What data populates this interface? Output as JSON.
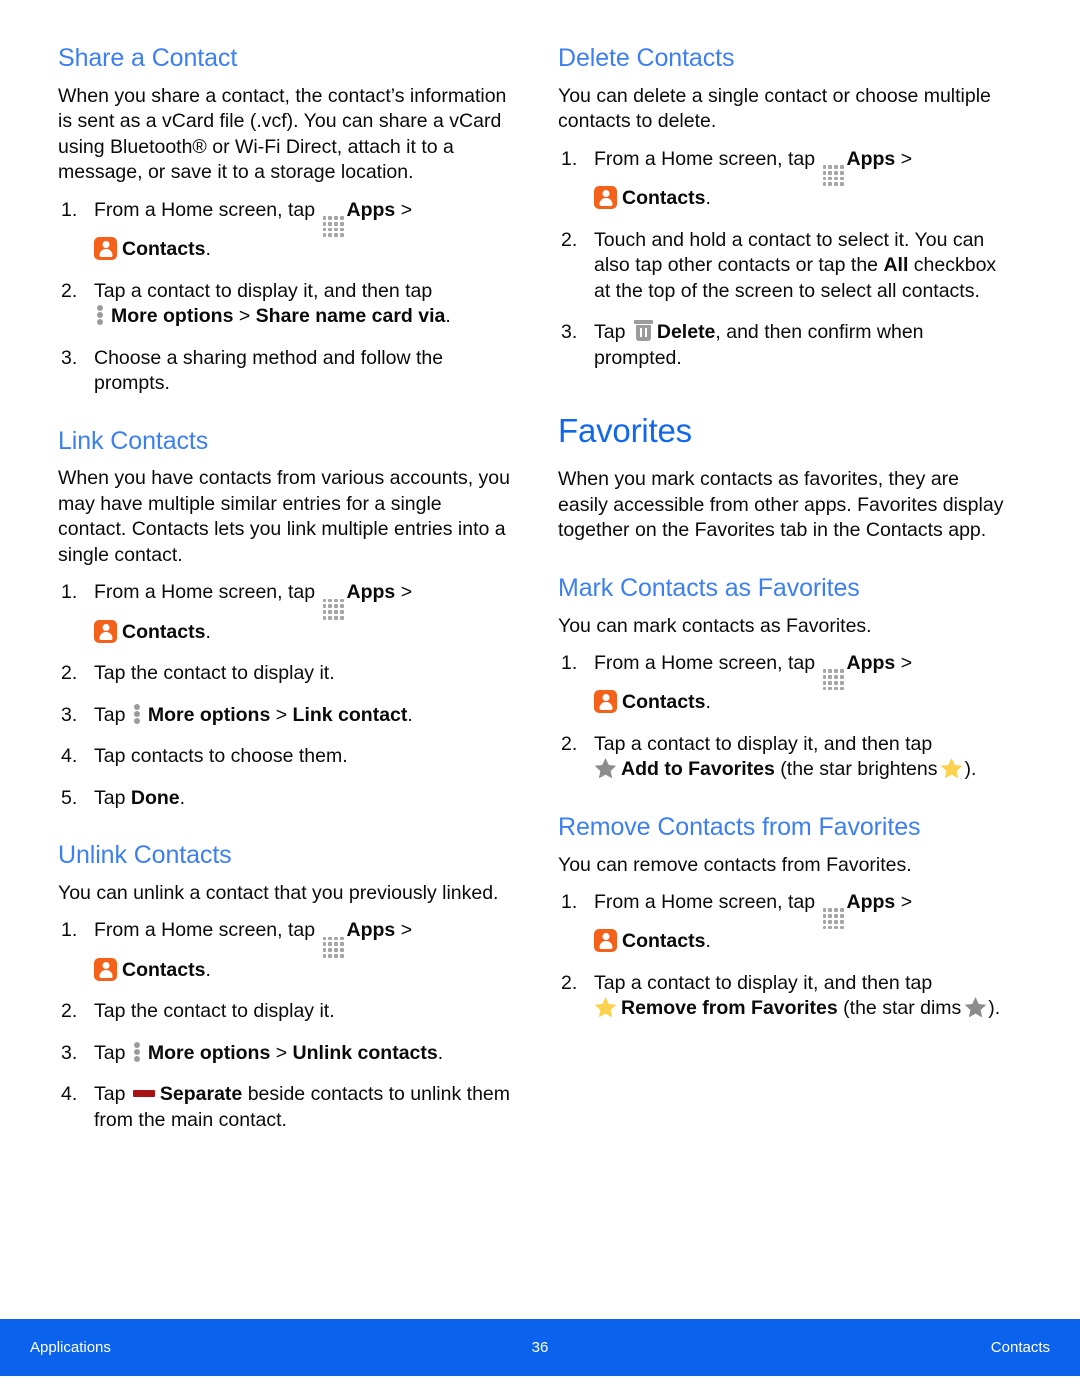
{
  "document": {
    "title": "Contacts — Share, Link, Unlink, Delete, Favorites"
  },
  "icons": {
    "apps": "apps-grid-icon",
    "contacts": "contacts-app-icon",
    "more_options": "more-options-icon",
    "delete": "trash-icon",
    "separate": "separate-dash-icon",
    "star_dim": "star-gray-icon",
    "star_bright": "star-yellow-icon"
  },
  "colors": {
    "h1_blue": "#1268ec",
    "h2_blue": "#3d7ff0",
    "footer_blue": "#0b63ed",
    "contacts_orange": "#f4611a",
    "icon_gray": "#9b9b9b",
    "separate_red": "#a81414",
    "star_gray": "#8c8c8c",
    "star_yellow": "#fcd14d"
  },
  "left_column": {
    "share_a_contact": {
      "heading": "Share a Contact",
      "intro": "When you share a contact, the contact’s information is sent as a vCard file (.vcf). You can share a vCard using Bluetooth® or Wi-Fi Direct, attach it to a message, or save it to a storage location.",
      "steps": {
        "s1_a": "From a Home screen, tap",
        "s1_apps": "Apps",
        "s1_gt": ">",
        "s1_contacts": "Contacts",
        "s1_period": ".",
        "s2_a": "Tap a contact to display it, and then tap",
        "s2_more": "More options",
        "s2_gt": ">",
        "s2_share": "Share name card via",
        "s2_period": ".",
        "s3": "Choose a sharing method and follow the prompts."
      }
    },
    "link_contacts": {
      "heading": "Link Contacts",
      "intro": "When you have contacts from various accounts, you may have multiple similar entries for a single contact. Contacts lets you link multiple entries into a single contact.",
      "steps": {
        "s1_a": "From a Home screen, tap",
        "s1_apps": "Apps",
        "s1_gt": ">",
        "s1_contacts": "Contacts",
        "s1_period": ".",
        "s2": "Tap the contact to display it.",
        "s3_tap": "Tap",
        "s3_more": "More options",
        "s3_gt": ">",
        "s3_link": "Link contact",
        "s3_period": ".",
        "s4": "Tap contacts to choose them.",
        "s5_tap": "Tap",
        "s5_done": "Done",
        "s5_period": "."
      }
    },
    "unlink_contacts": {
      "heading": "Unlink Contacts",
      "intro": "You can unlink a contact that you previously linked.",
      "steps": {
        "s1_a": "From a Home screen, tap",
        "s1_apps": "Apps",
        "s1_gt": ">",
        "s1_contacts": "Contacts",
        "s1_period": ".",
        "s2": "Tap the contact to display it.",
        "s3_tap": "Tap",
        "s3_more": "More options",
        "s3_gt": ">",
        "s3_unlink": "Unlink contacts",
        "s3_period": ".",
        "s4_tap": "Tap",
        "s4_separate": "Separate",
        "s4_rest": "beside contacts to unlink them from the main contact."
      }
    }
  },
  "right_column": {
    "delete_contacts": {
      "heading": "Delete Contacts",
      "intro": "You can delete a single contact or choose multiple contacts to delete.",
      "steps": {
        "s1_a": "From a Home screen, tap",
        "s1_apps": "Apps",
        "s1_gt": ">",
        "s1_contacts": "Contacts",
        "s1_period": ".",
        "s2_a": "Touch and hold a contact to select it. You can also tap other contacts or tap the",
        "s2_all": "All",
        "s2_b": "checkbox at the top of the screen to select all contacts.",
        "s3_tap": "Tap",
        "s3_delete": "Delete",
        "s3_rest": ", and then confirm when prompted."
      }
    },
    "favorites": {
      "heading": "Favorites",
      "intro": "When you mark contacts as favorites, they are easily accessible from other apps. Favorites display together on the Favorites tab in the Contacts app."
    },
    "mark_contacts_as_favorites": {
      "heading": "Mark Contacts as Favorites",
      "intro": "You can mark contacts as Favorites.",
      "steps": {
        "s1_a": "From a Home screen, tap",
        "s1_apps": "Apps",
        "s1_gt": ">",
        "s1_contacts": "Contacts",
        "s1_period": ".",
        "s2_a": "Tap a contact to display it, and then tap",
        "s2_add": "Add to Favorites",
        "s2_paren_open": "(the star brightens",
        "s2_paren_close": ")."
      }
    },
    "remove_contacts_from_favorites": {
      "heading": "Remove Contacts from Favorites",
      "intro": "You can remove contacts from Favorites.",
      "steps": {
        "s1_a": "From a Home screen, tap",
        "s1_apps": "Apps",
        "s1_gt": ">",
        "s1_contacts": "Contacts",
        "s1_period": ".",
        "s2_a": "Tap a contact to display it, and then tap",
        "s2_remove": "Remove from Favorites",
        "s2_paren_open": "(the star dims",
        "s2_paren_close": ")."
      }
    }
  },
  "footer": {
    "left": "Applications",
    "page_number": "36",
    "right": "Contacts"
  }
}
